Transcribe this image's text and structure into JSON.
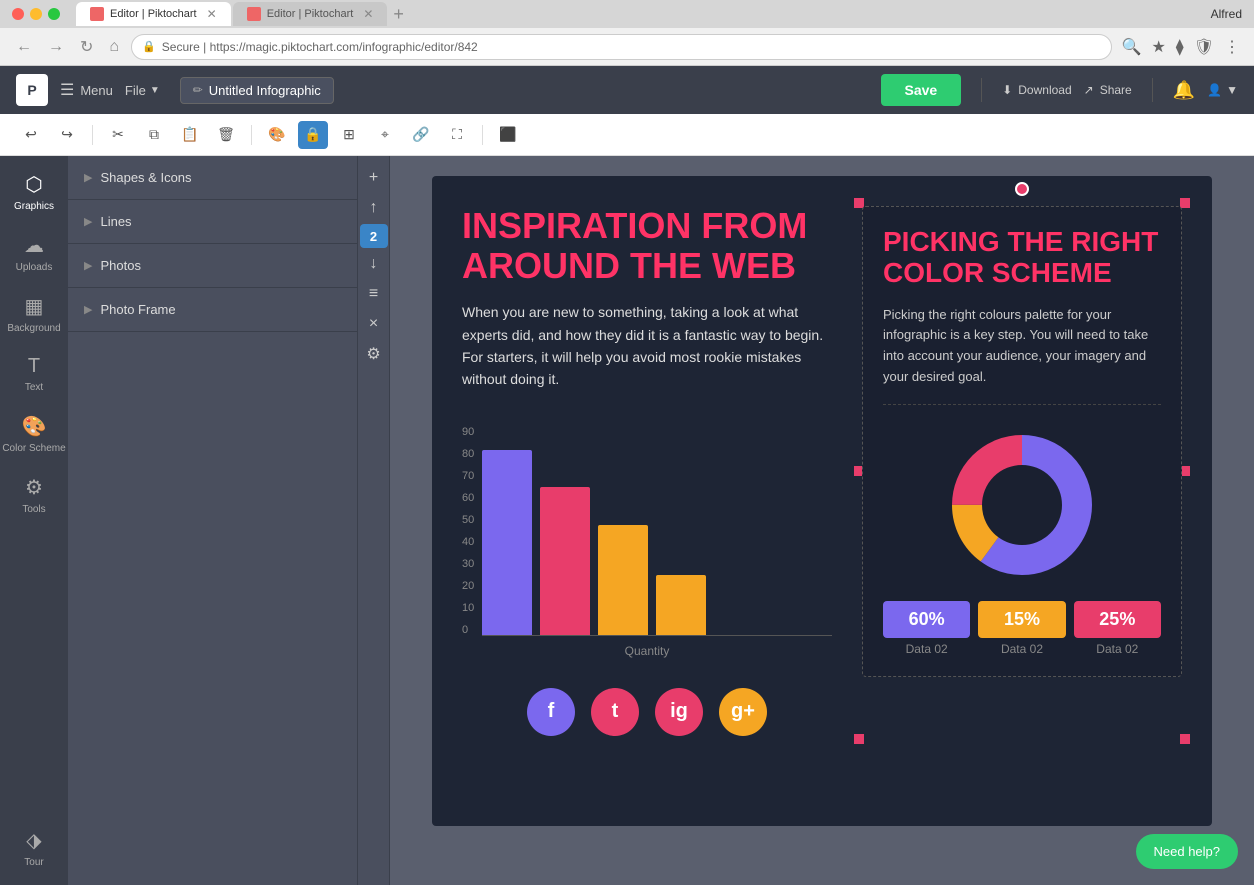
{
  "browser": {
    "tab1_title": "Editor | Piktochart",
    "tab2_title": "Editor | Piktochart",
    "url": "https://magic.piktochart.com/infographic/editor/842",
    "url_display": "Secure | https://magic.piktochart.com/infographic/editor/842",
    "user_name": "Alfred"
  },
  "toolbar": {
    "menu_label": "Menu",
    "file_label": "File",
    "title": "Untitled Infographic",
    "save_label": "Save",
    "download_label": "Download",
    "share_label": "Share"
  },
  "sidebar": {
    "graphics_label": "Graphics",
    "uploads_label": "Uploads",
    "background_label": "Background",
    "text_label": "Text",
    "color_scheme_label": "Color Scheme",
    "tools_label": "Tools",
    "tour_label": "Tour"
  },
  "panel": {
    "shapes_icons_label": "Shapes & Icons",
    "lines_label": "Lines",
    "photos_label": "Photos",
    "photo_frame_label": "Photo Frame"
  },
  "canvas_toolbar": {
    "undo_label": "Undo",
    "redo_label": "Redo",
    "cut_label": "Cut",
    "copy_label": "Copy",
    "paste_label": "Paste",
    "delete_label": "Delete",
    "lock_label": "Lock",
    "grid_label": "Grid",
    "link_label": "Link"
  },
  "side_controls": {
    "add_label": "+",
    "move_up_label": "↑",
    "page_number": "2",
    "move_down_label": "↓",
    "align_label": "≡",
    "close_label": "×",
    "settings_label": "⚙"
  },
  "infographic": {
    "left_title": "INSPIRATION FROM AROUND THE WEB",
    "left_body": "When you are new to something, taking a look at what experts did, and how they did it is a fantastic way to begin. For starters, it will help you avoid most rookie mistakes without doing it.",
    "chart_label": "Quantity",
    "y_axis": [
      "0",
      "10",
      "20",
      "30",
      "40",
      "50",
      "60",
      "70",
      "80",
      "90"
    ],
    "right_title": "PICKING THE RIGHT COLOR SCHEME",
    "right_body": "Picking the right colours palette for your infographic is a key step. You will need to take into account your audience, your imagery and your desired goal.",
    "data_items": [
      {
        "pct": "60%",
        "label": "Data 02",
        "color": "purple"
      },
      {
        "pct": "15%",
        "label": "Data 02",
        "color": "orange"
      },
      {
        "pct": "25%",
        "label": "Data 02",
        "color": "red"
      }
    ]
  },
  "help": {
    "label": "Need help?"
  },
  "colors": {
    "accent_green": "#2ecc71",
    "accent_red": "#e83d6b",
    "accent_purple": "#7b68ee",
    "accent_orange": "#f5a623",
    "toolbar_bg": "#3a3f4b",
    "sidebar_bg": "#4a4f5e",
    "canvas_bg": "#5a5f6e",
    "infographic_bg": "#1e2535"
  }
}
